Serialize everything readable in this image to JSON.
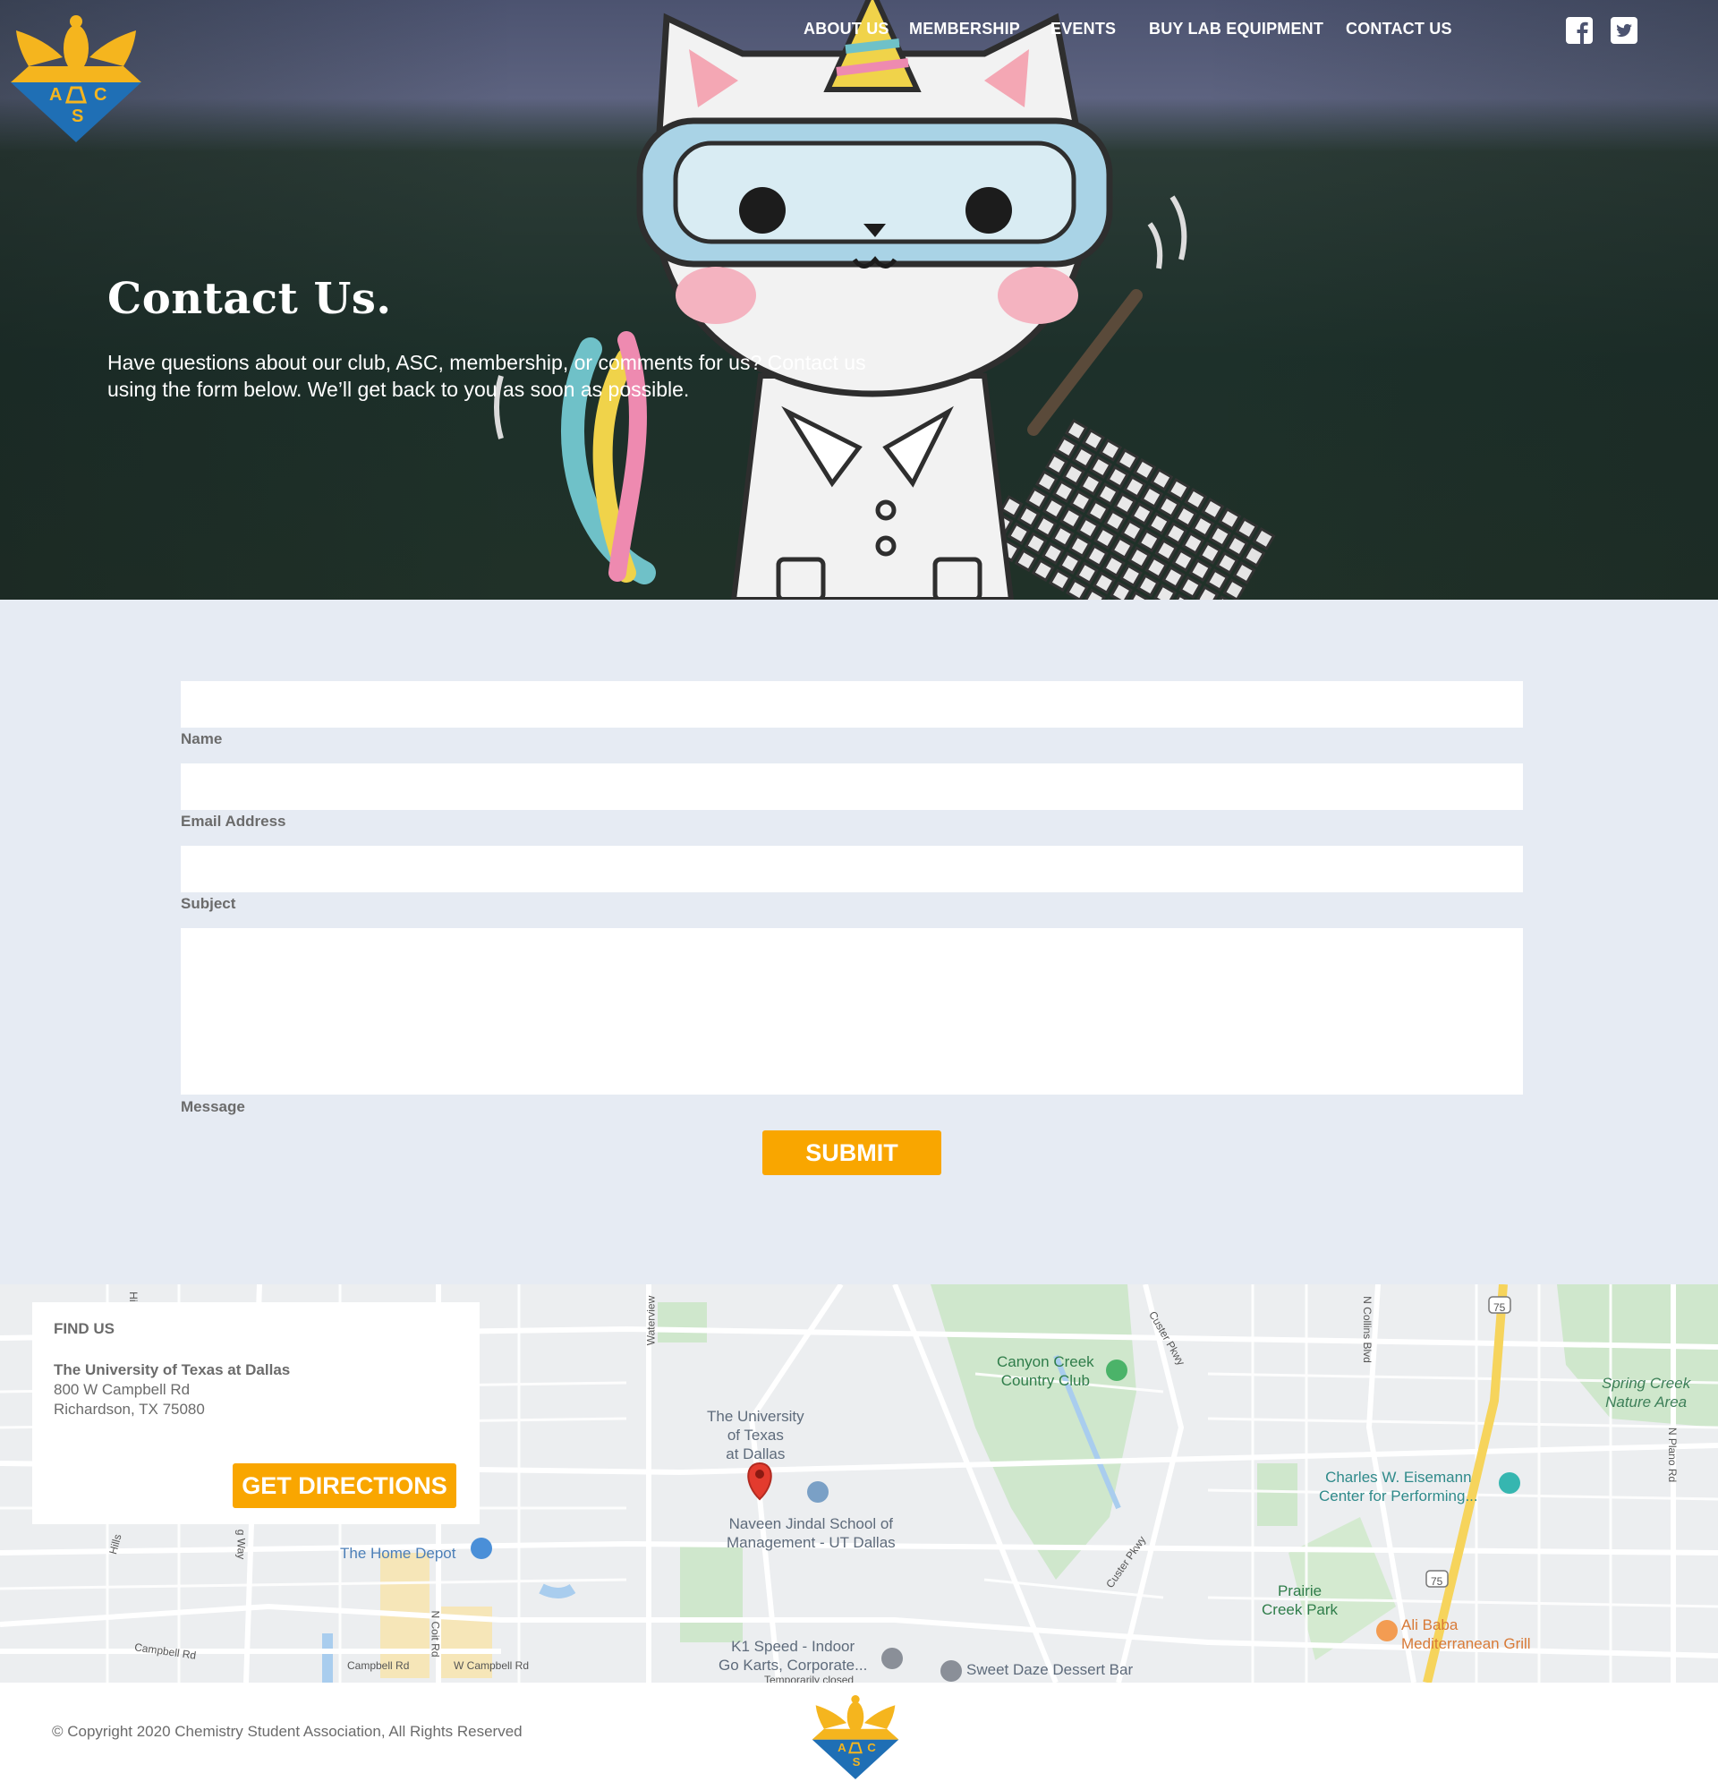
{
  "brand": {
    "logo_letters": [
      "A",
      "C",
      "S"
    ],
    "accent": "#f9a600",
    "logo_gold": "#f5b51e",
    "logo_blue": "#1f6fb5"
  },
  "nav": {
    "items": [
      "ABOUT US",
      "MEMBERSHIP",
      "EVENTS",
      "BUY LAB EQUIPMENT",
      "CONTACT US"
    ],
    "social": [
      "facebook-icon",
      "twitter-icon"
    ]
  },
  "hero": {
    "title": "Contact Us.",
    "text": "Have questions about our club, ASC, membership, or comments for us? Contact us using the form below. We’ll get back to you as soon as possible."
  },
  "form": {
    "name_label": "Name",
    "name_value": "",
    "email_label": "Email Address",
    "email_value": "",
    "subject_label": "Subject",
    "subject_value": "",
    "message_label": "Message",
    "message_value": "",
    "submit_label": "SUBMIT"
  },
  "find_us": {
    "title": "FIND US",
    "name": "The University of Texas at Dallas",
    "address_line1": "800 W Campbell Rd",
    "address_line2": "Richardson, TX 75080",
    "directions_label": "GET DIRECTIONS"
  },
  "map": {
    "labels": {
      "utd": "The University\nof Texas\nat Dallas",
      "jindal": "Naveen Jindal School of\nManagement - UT Dallas",
      "canyon": "Canyon Creek\nCountry Club",
      "spring": "Spring Creek\nNature Area",
      "eisemann": "Charles W. Eisemann\nCenter for Performing...",
      "home_depot": "The Home Depot",
      "prairie": "Prairie\nCreek Park",
      "alibaba": "Ali Baba\nMediterranean Grill",
      "k1": "K1 Speed - Indoor\nGo Karts, Corporate...",
      "k1_note": "Temporarily closed",
      "sweet": "Sweet Daze Dessert Bar",
      "campbell_left": "Campbell Rd",
      "campbell_mid": "Campbell Rd",
      "w_campbell": "W Campbell Rd",
      "coit": "N Coit Rd",
      "waterview": "Waterview",
      "custer1": "Custer Pkwy",
      "custer2": "Custer Pkwy",
      "collins": "N Collins Blvd",
      "plano": "N Plano Rd",
      "hwy75a": "75",
      "hwy75b": "75",
      "hill1": "Hill",
      "hill2": "Hills",
      "way": "g Way"
    }
  },
  "footer": {
    "copyright": "© Copyright 2020 Chemistry Student Association, All Rights Reserved"
  }
}
